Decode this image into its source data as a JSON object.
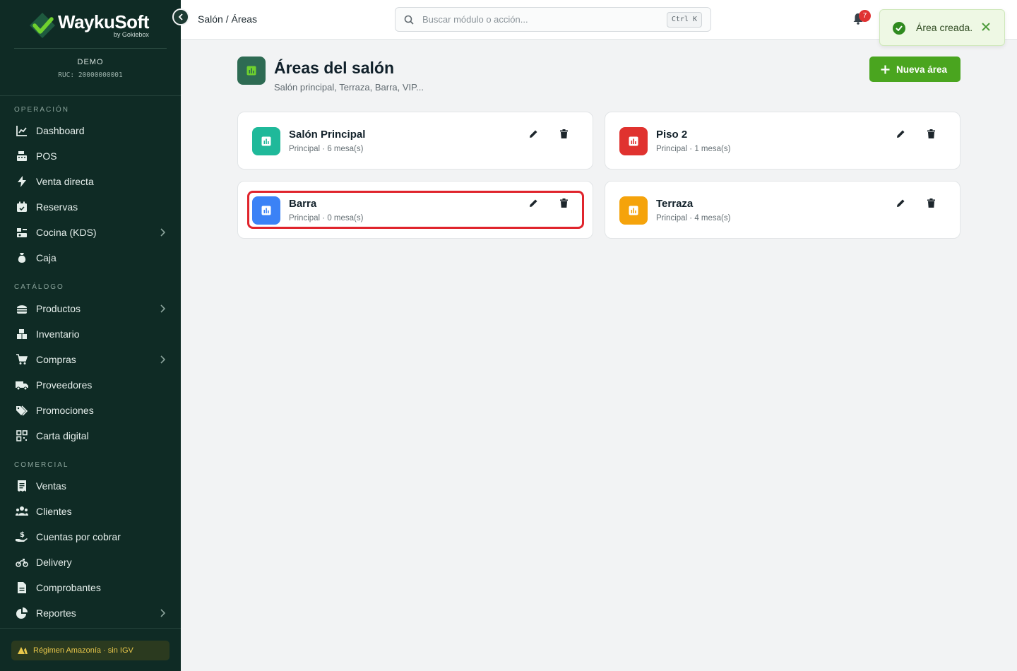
{
  "sidebar": {
    "brand": {
      "name": "WaykuSoft",
      "by": "by Gokiebox"
    },
    "company": "DEMO",
    "ruc": "RUC: 20000000001",
    "sections": [
      {
        "title": "OPERACIÓN",
        "items": [
          {
            "label": "Dashboard",
            "icon": "chart-line-icon",
            "chevron": false
          },
          {
            "label": "POS",
            "icon": "cash-register-icon",
            "chevron": false
          },
          {
            "label": "Venta directa",
            "icon": "bolt-icon",
            "chevron": false
          },
          {
            "label": "Reservas",
            "icon": "calendar-check-icon",
            "chevron": false
          },
          {
            "label": "Cocina (KDS)",
            "icon": "kitchen-icon",
            "chevron": true
          },
          {
            "label": "Caja",
            "icon": "money-bag-icon",
            "chevron": false
          }
        ]
      },
      {
        "title": "CATÁLOGO",
        "items": [
          {
            "label": "Productos",
            "icon": "burger-icon",
            "chevron": true
          },
          {
            "label": "Inventario",
            "icon": "boxes-icon",
            "chevron": false
          },
          {
            "label": "Compras",
            "icon": "cart-icon",
            "chevron": true
          },
          {
            "label": "Proveedores",
            "icon": "truck-icon",
            "chevron": false
          },
          {
            "label": "Promociones",
            "icon": "tags-icon",
            "chevron": false
          },
          {
            "label": "Carta digital",
            "icon": "qrcode-icon",
            "chevron": false
          }
        ]
      },
      {
        "title": "COMERCIAL",
        "items": [
          {
            "label": "Ventas",
            "icon": "receipt-icon",
            "chevron": false
          },
          {
            "label": "Clientes",
            "icon": "users-icon",
            "chevron": false
          },
          {
            "label": "Cuentas por cobrar",
            "icon": "hand-dollar-icon",
            "chevron": false
          },
          {
            "label": "Delivery",
            "icon": "motorcycle-icon",
            "chevron": false
          },
          {
            "label": "Comprobantes",
            "icon": "file-icon",
            "chevron": false
          },
          {
            "label": "Reportes",
            "icon": "pie-chart-icon",
            "chevron": true
          }
        ]
      }
    ],
    "footer_badge": "Régimen Amazonía · sin IGV"
  },
  "topbar": {
    "breadcrumb": "Salón / Áreas",
    "search_placeholder": "Buscar módulo o acción...",
    "search_shortcut": "Ctrl K",
    "notifications_count": "7"
  },
  "toast": {
    "message": "Área creada."
  },
  "page": {
    "title": "Áreas del salón",
    "subtitle": "Salón principal, Terraza, Barra, VIP...",
    "new_button": "Nueva área"
  },
  "areas": [
    {
      "name": "Salón Principal",
      "meta": "Principal · 6 mesa(s)",
      "color": "#1fb99a"
    },
    {
      "name": "Piso 2",
      "meta": "Principal · 1 mesa(s)",
      "color": "#e0322f"
    },
    {
      "name": "Barra",
      "meta": "Principal · 0 mesa(s)",
      "color": "#3b82f6"
    },
    {
      "name": "Terraza",
      "meta": "Principal · 4 mesa(s)",
      "color": "#f5a30b"
    }
  ],
  "colors": {
    "sidebar_bg": "#0f2b25",
    "accent": "#4aa51f",
    "highlight": "#e0242c"
  }
}
